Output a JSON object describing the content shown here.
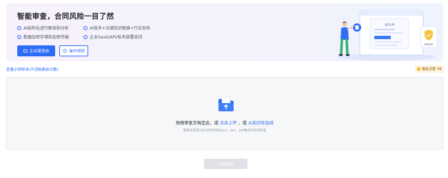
{
  "banner": {
    "title": "智能审查，合同风险一目了然",
    "features": [
      "AI结构化进行解读和分析",
      "AI技术+法律知识图谱+行业百科",
      "数据加密存储和加密传输",
      "企业SaaS/API/私有部署支持"
    ],
    "primary_button": "企业版咨询",
    "secondary_button": "操作视频",
    "illustration": {
      "doc_title": "合同名称",
      "shield_label": "审查完成"
    }
  },
  "sample_link": "查看示例样本(不消耗剩余次数)",
  "quota": {
    "label": "剩余次数",
    "value": "49"
  },
  "upload": {
    "main_prefix": "拖拽审查文档至此，或",
    "link_upload": "点击上传",
    "separator": "，或",
    "link_library": "从知识库选择",
    "hint": "限单仅支持1份100M内的docx、doc、pdf格式的合同审查"
  },
  "start_button": "开始审查",
  "colors": {
    "accent": "#2f6cf6",
    "quota_bg": "#fdf3da",
    "upload_bg": "#f6f7f9"
  }
}
